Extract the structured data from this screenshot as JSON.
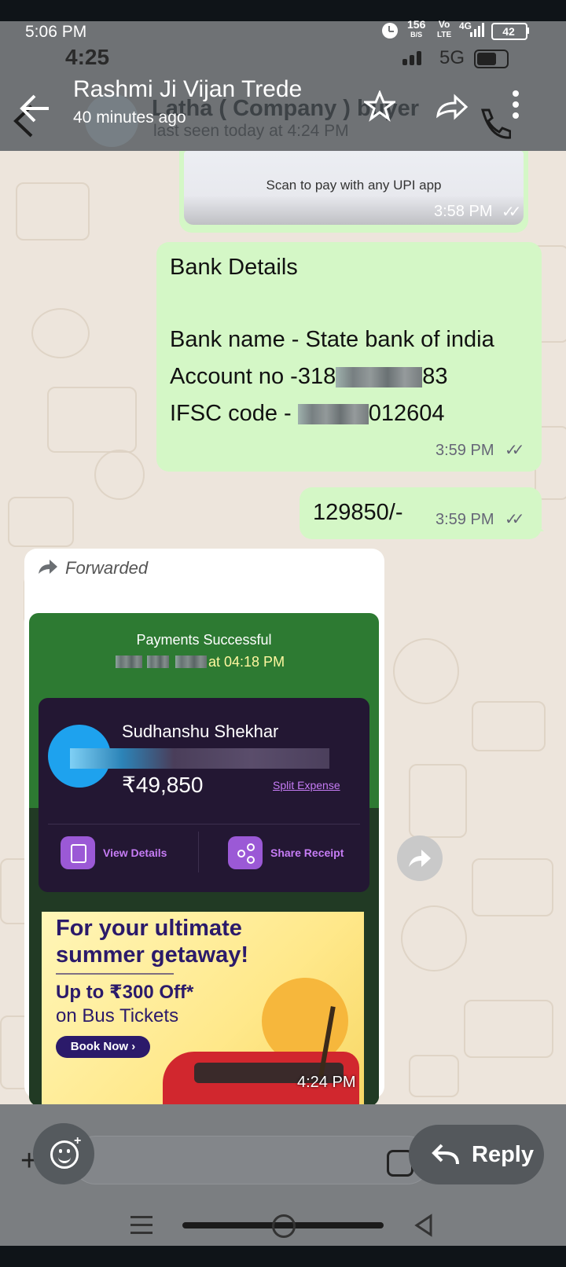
{
  "system_status": {
    "time": "5:06 PM",
    "net_speed_top": "156",
    "net_speed_bottom": "B/S",
    "volte_top": "Vo",
    "volte_bottom": "LTE",
    "network": "4G",
    "battery": "42"
  },
  "inner_status": {
    "time": "4:25",
    "network": "5G"
  },
  "header": {
    "contact_name": "Rashmi Ji Vijan Trede",
    "last_seen": "40 minutes ago",
    "underlay_name": "Latha ( Company ) buyer",
    "underlay_last_seen": "last seen today at 4:24 PM"
  },
  "messages": {
    "qr_caption": "Scan to pay with any UPI app",
    "qr_time": "3:58 PM",
    "bank_title": "Bank Details",
    "bank_name": "Bank name - State bank of india",
    "account_prefix": "Account no -318",
    "account_suffix": "83",
    "ifsc_prefix": "IFSC code - ",
    "ifsc_suffix": "012604",
    "bank_time": "3:59 PM",
    "amount_text": "129850/-",
    "amount_time": "3:59 PM",
    "forwarded_label": "Forwarded",
    "forwarded_time": "4:24 PM"
  },
  "payment_card": {
    "title": "Payments Successful",
    "time_suffix": "at 04:18 PM",
    "payee_name": "Sudhanshu Shekhar",
    "amount": "₹49,850",
    "split_expense": "Split Expense",
    "view_details": "View Details",
    "share_receipt": "Share Receipt"
  },
  "ad_banner": {
    "headline_line1": "For your ultimate",
    "headline_line2": "summer getaway!",
    "offer_line1": "Up to ₹300 Off*",
    "offer_line2": "on Bus Tickets",
    "cta": "Book Now ›"
  },
  "composer": {
    "reply_label": "Reply"
  },
  "colors": {
    "header_bg": "#6f7275",
    "chat_bg": "#ede5dc",
    "outgoing_bubble": "#d4f7c6",
    "payment_green": "#2d7a32",
    "payment_dark": "#231733",
    "purple_accent": "#9b59d6"
  }
}
